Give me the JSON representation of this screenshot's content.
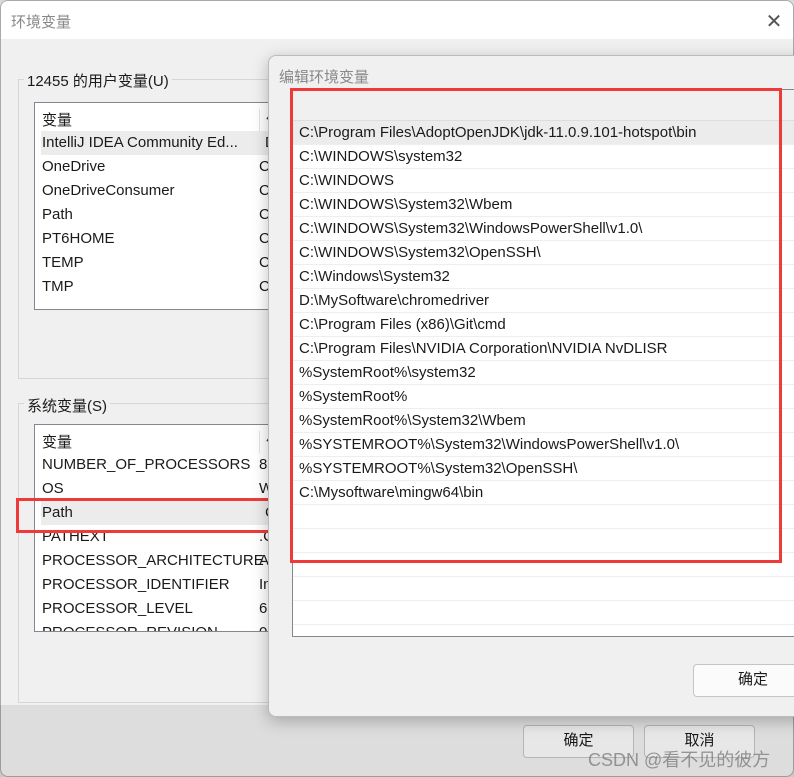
{
  "main_dialog": {
    "title": "环境变量",
    "close_icon": "close-icon",
    "user_vars": {
      "label": "12455 的用户变量(U)",
      "col_name": "变量",
      "col_value": "值",
      "rows": [
        {
          "name": "IntelliJ IDEA Community Ed...",
          "value": "D"
        },
        {
          "name": "OneDrive",
          "value": "C"
        },
        {
          "name": "OneDriveConsumer",
          "value": "C"
        },
        {
          "name": "Path",
          "value": "C"
        },
        {
          "name": "PT6HOME",
          "value": "C"
        },
        {
          "name": "TEMP",
          "value": "C"
        },
        {
          "name": "TMP",
          "value": "C"
        }
      ]
    },
    "system_vars": {
      "label": "系统变量(S)",
      "col_name": "变量",
      "col_value": "值",
      "rows": [
        {
          "name": "NUMBER_OF_PROCESSORS",
          "value": "8"
        },
        {
          "name": "OS",
          "value": "W"
        },
        {
          "name": "Path",
          "value": "C"
        },
        {
          "name": "PATHEXT",
          "value": ".C"
        },
        {
          "name": "PROCESSOR_ARCHITECTURE",
          "value": "A"
        },
        {
          "name": "PROCESSOR_IDENTIFIER",
          "value": "In"
        },
        {
          "name": "PROCESSOR_LEVEL",
          "value": "6"
        },
        {
          "name": "PROCESSOR_REVISION",
          "value": "0"
        }
      ]
    },
    "ok": "确定",
    "cancel": "取消"
  },
  "edit_dialog": {
    "title": "编辑环境变量",
    "ok": "确定",
    "entries": [
      "C:\\Program Files\\AdoptOpenJDK\\jdk-11.0.9.101-hotspot\\bin",
      "C:\\WINDOWS\\system32",
      "C:\\WINDOWS",
      "C:\\WINDOWS\\System32\\Wbem",
      "C:\\WINDOWS\\System32\\WindowsPowerShell\\v1.0\\",
      "C:\\WINDOWS\\System32\\OpenSSH\\",
      "C:\\Windows\\System32",
      "D:\\MySoftware\\chromedriver",
      "C:\\Program Files (x86)\\Git\\cmd",
      "C:\\Program Files\\NVIDIA Corporation\\NVIDIA NvDLISR",
      "%SystemRoot%\\system32",
      "%SystemRoot%",
      "%SystemRoot%\\System32\\Wbem",
      "%SYSTEMROOT%\\System32\\WindowsPowerShell\\v1.0\\",
      "%SYSTEMROOT%\\System32\\OpenSSH\\",
      "C:\\Mysoftware\\mingw64\\bin"
    ]
  },
  "highlight_color": "#f03a3a",
  "watermark": "CSDN @看不见的彼方"
}
